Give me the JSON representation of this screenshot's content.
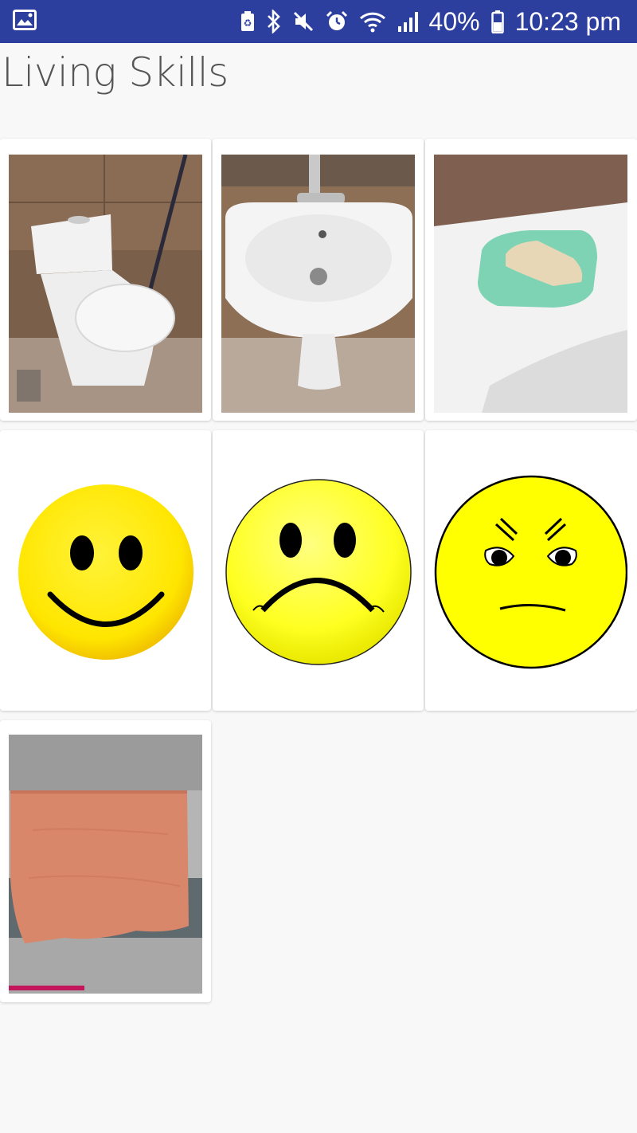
{
  "status_bar": {
    "battery_percent": "40%",
    "time": "10:23 pm",
    "background_color": "#2c3e9e",
    "icons": [
      "gallery-icon",
      "battery-saver-icon",
      "bluetooth-icon",
      "mute-icon",
      "alarm-icon",
      "wifi-icon",
      "signal-icon",
      "battery-icon"
    ]
  },
  "app": {
    "title": "Living Skills"
  },
  "grid": {
    "items": [
      {
        "name": "toilet"
      },
      {
        "name": "sink"
      },
      {
        "name": "soap"
      },
      {
        "name": "happy-face"
      },
      {
        "name": "sad-face"
      },
      {
        "name": "angry-face"
      },
      {
        "name": "towel"
      }
    ]
  },
  "colors": {
    "face_yellow": "#ffee00",
    "towel_orange": "#d9876b"
  }
}
